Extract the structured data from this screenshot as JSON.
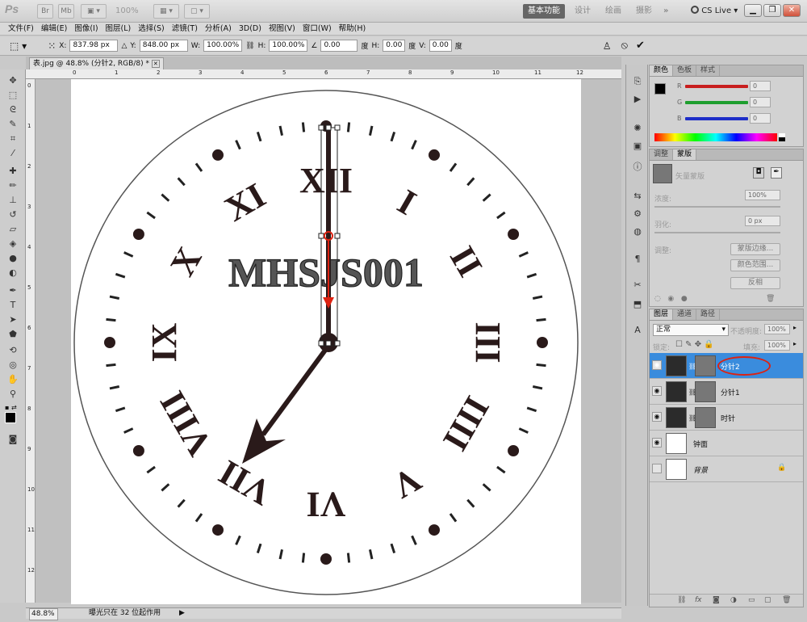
{
  "app": {
    "logo": "Ps",
    "zoom": "100%",
    "workspaces": [
      "基本功能",
      "设计",
      "绘画",
      "摄影"
    ],
    "more": "»",
    "cs_live": "CS Live"
  },
  "menu": [
    "文件(F)",
    "编辑(E)",
    "图像(I)",
    "图层(L)",
    "选择(S)",
    "滤镜(T)",
    "分析(A)",
    "3D(D)",
    "视图(V)",
    "窗口(W)",
    "帮助(H)"
  ],
  "options": {
    "x_label": "X:",
    "x_value": "837.98 px",
    "y_label": "Y:",
    "y_value": "848.00 px",
    "w_label": "W:",
    "w_value": "100.00%",
    "h_label": "H:",
    "h_value": "100.00%",
    "angle_value": "0.00",
    "angle_unit": "度",
    "hskew_label": "H:",
    "hskew_value": "0.00",
    "hskew_unit": "度",
    "vskew_label": "V:",
    "vskew_value": "0.00",
    "vskew_unit": "度"
  },
  "document": {
    "tab_title": "表.jpg @ 48.8% (分针2, RGB/8) *",
    "zoom": "48.8%",
    "status_text": "曝光只在 32 位起作用"
  },
  "clock": {
    "text": "MHSJS001",
    "numerals": [
      "XII",
      "I",
      "II",
      "III",
      "IIII",
      "V",
      "VI",
      "VII",
      "VIII",
      "IX",
      "X",
      "XI"
    ]
  },
  "rulers": {
    "h": [
      "0",
      "1",
      "2",
      "3",
      "4",
      "5",
      "6",
      "7",
      "8",
      "9",
      "10",
      "11",
      "12"
    ],
    "v": [
      "0",
      "1",
      "2",
      "3",
      "4",
      "5",
      "6",
      "7",
      "8",
      "9",
      "10",
      "11",
      "12"
    ]
  },
  "color_panel": {
    "tabs": [
      "颜色",
      "色板",
      "样式"
    ],
    "channels": [
      {
        "label": "R",
        "value": "0",
        "color": "#c81e1e"
      },
      {
        "label": "G",
        "value": "0",
        "color": "#1e9e2e"
      },
      {
        "label": "B",
        "value": "0",
        "color": "#1e2ec8"
      }
    ]
  },
  "mask_panel": {
    "tabs": [
      "调整",
      "蒙版"
    ],
    "mask_title": "矢量蒙版",
    "density_label": "浓度:",
    "density_value": "100%",
    "feather_label": "羽化:",
    "feather_value": "0 px",
    "refine_label": "调整:",
    "btn_edge": "蒙版边缘...",
    "btn_range": "颜色范围...",
    "btn_invert": "反相"
  },
  "layers_panel": {
    "tabs": [
      "图层",
      "通道",
      "路径"
    ],
    "blend_mode": "正常",
    "opacity_label": "不透明度:",
    "opacity_value": "100%",
    "lock_label": "锁定:",
    "fill_label": "填充:",
    "fill_value": "100%",
    "layers": [
      {
        "name": "分针2",
        "selected": true
      },
      {
        "name": "分针1",
        "selected": false
      },
      {
        "name": "时针",
        "selected": false
      },
      {
        "name": "钟面",
        "selected": false
      },
      {
        "name": "背景",
        "selected": false
      }
    ]
  }
}
